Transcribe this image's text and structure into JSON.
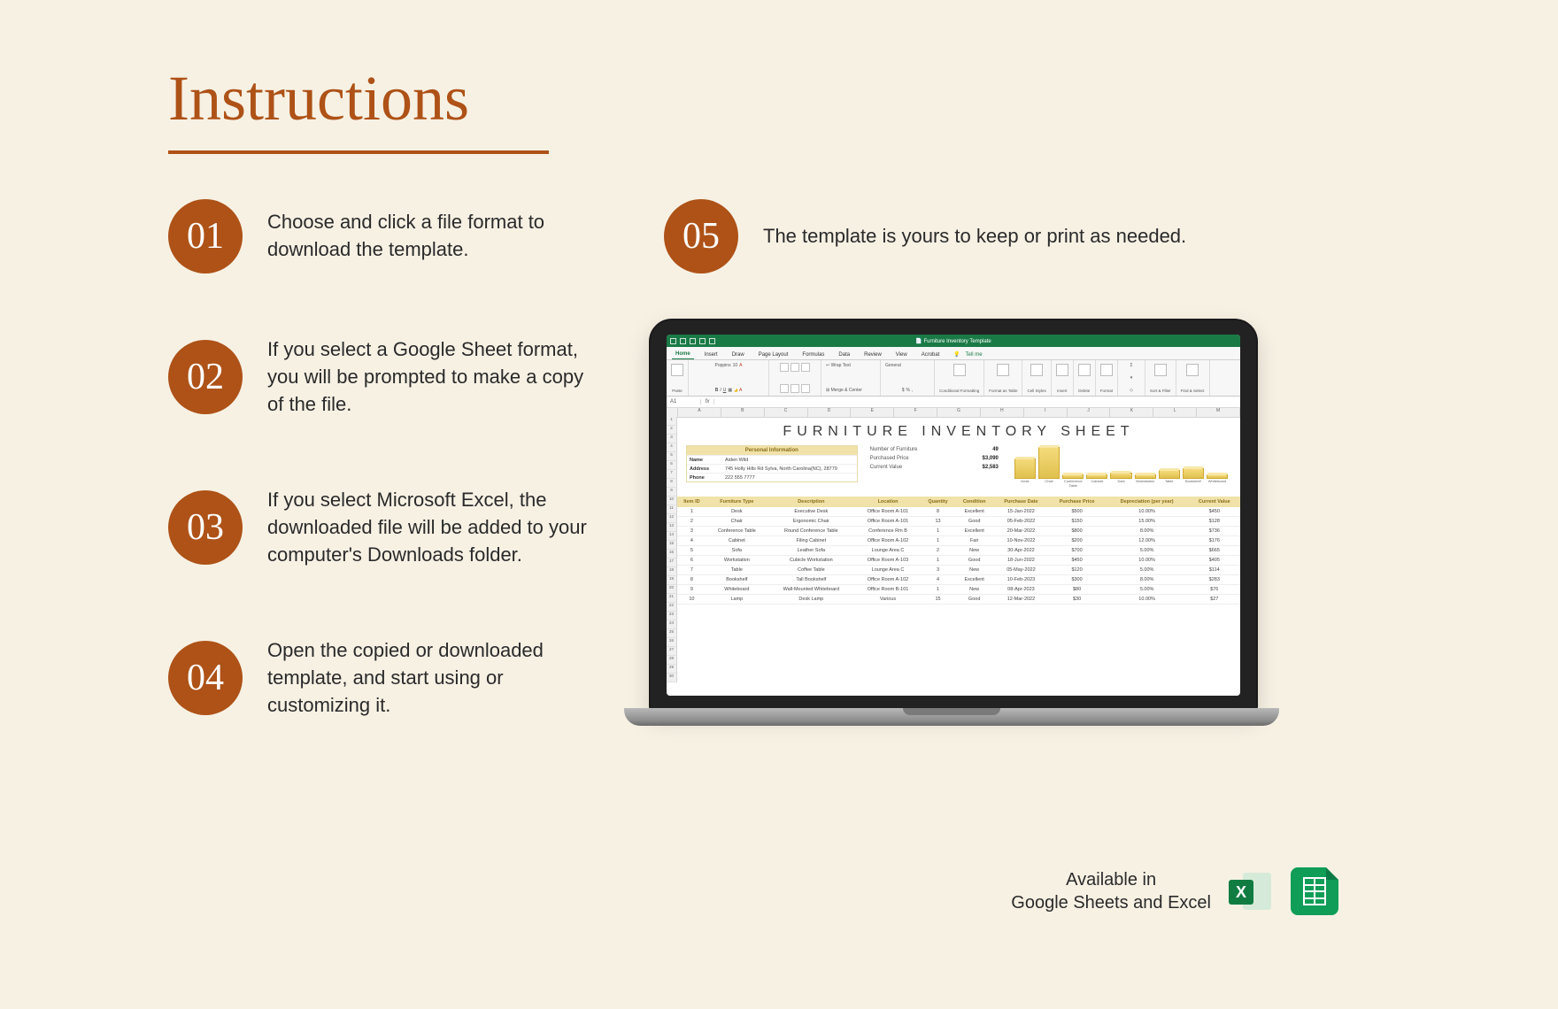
{
  "title": "Instructions",
  "steps": [
    {
      "num": "01",
      "text": "Choose and click a file format to download the template."
    },
    {
      "num": "02",
      "text": "If you select a Google Sheet format, you will be prompted to make a copy of the file."
    },
    {
      "num": "03",
      "text": "If you select Microsoft Excel, the downloaded file will be added to your computer's Downloads folder."
    },
    {
      "num": "04",
      "text": "Open the copied or downloaded template, and start using or customizing it."
    },
    {
      "num": "05",
      "text": "The template is yours to keep or print as needed."
    }
  ],
  "availability": {
    "line1": "Available in",
    "line2": "Google Sheets and Excel"
  },
  "excel": {
    "titlebar": {
      "filename": "Furniture Inventory Template"
    },
    "tabs": [
      "Home",
      "Insert",
      "Draw",
      "Page Layout",
      "Formulas",
      "Data",
      "Review",
      "View",
      "Acrobat"
    ],
    "tellme": "Tell me",
    "ribbon": {
      "paste": "Paste",
      "font_name": "Poppins",
      "font_size": "10",
      "wrap": "Wrap Text",
      "merge": "Merge & Center",
      "number_fmt": "General",
      "conditional": "Conditional Formatting",
      "format_table": "Format as Table",
      "cell_styles": "Cell Styles",
      "insert": "Insert",
      "delete": "Delete",
      "format": "Format",
      "sort": "Sort & Filter",
      "find": "Find & Select"
    },
    "formulabar": {
      "cell": "A1",
      "fx": "fx"
    },
    "sheet_title": "FURNITURE INVENTORY SHEET",
    "personal": {
      "header": "Personal Information",
      "name_k": "Name",
      "name_v": "Aiden Wild",
      "addr_k": "Address",
      "addr_v": "745 Holly Hills Rd Sylva, North Carolina(NC), 28779",
      "phone_k": "Phone",
      "phone_v": "222 555 7777"
    },
    "summary": {
      "count_k": "Number of Furniture",
      "count_v": "49",
      "price_k": "Purchased Price",
      "price_v": "$3,090",
      "value_k": "Current Value",
      "value_v": "$2,583"
    },
    "chart": {
      "labels": [
        "Desk",
        "Chair",
        "Conference Table",
        "Cabinet",
        "Sofa",
        "Workstation",
        "Table",
        "Bookshelf",
        "Whiteboard"
      ]
    },
    "columns": [
      "Item ID",
      "Furniture Type",
      "Description",
      "Location",
      "Quantity",
      "Condition",
      "Purchase Date",
      "Purchase Price",
      "Depreciation (per year)",
      "Current Value"
    ],
    "rows": [
      {
        "id": "1",
        "type": "Desk",
        "desc": "Executive Desk",
        "loc": "Office Room A-101",
        "qty": "8",
        "cond": "Excellent",
        "cond_class": "excellent",
        "date": "15-Jan-2022",
        "price": "$500",
        "dep": "10.00%",
        "val": "$450"
      },
      {
        "id": "2",
        "type": "Chair",
        "desc": "Ergonomic Chair",
        "loc": "Office Room A-101",
        "qty": "13",
        "cond": "Good",
        "cond_class": "good",
        "date": "05-Feb-2022",
        "price": "$150",
        "dep": "15.00%",
        "val": "$128"
      },
      {
        "id": "3",
        "type": "Conference Table",
        "desc": "Round Conference Table",
        "loc": "Conference Rm B",
        "qty": "1",
        "cond": "Excellent",
        "cond_class": "excellent",
        "date": "20-Mar-2022",
        "price": "$800",
        "dep": "8.00%",
        "val": "$736"
      },
      {
        "id": "4",
        "type": "Cabinet",
        "desc": "Filing Cabinet",
        "loc": "Office Room A-102",
        "qty": "1",
        "cond": "Fair",
        "cond_class": "fair",
        "date": "10-Nov-2022",
        "price": "$200",
        "dep": "12.00%",
        "val": "$176"
      },
      {
        "id": "5",
        "type": "Sofa",
        "desc": "Leather Sofa",
        "loc": "Lounge Area C",
        "qty": "2",
        "cond": "New",
        "cond_class": "new",
        "date": "30-Apr-2022",
        "price": "$700",
        "dep": "5.00%",
        "val": "$665"
      },
      {
        "id": "6",
        "type": "Workstation",
        "desc": "Cubicle Workstation",
        "loc": "Office Room A-103",
        "qty": "1",
        "cond": "Good",
        "cond_class": "good",
        "date": "18-Jun-2022",
        "price": "$450",
        "dep": "10.00%",
        "val": "$405"
      },
      {
        "id": "7",
        "type": "Table",
        "desc": "Coffee Table",
        "loc": "Lounge Area C",
        "qty": "3",
        "cond": "New",
        "cond_class": "new",
        "date": "05-May-2022",
        "price": "$120",
        "dep": "5.00%",
        "val": "$114"
      },
      {
        "id": "8",
        "type": "Bookshelf",
        "desc": "Tall Bookshelf",
        "loc": "Office Room A-102",
        "qty": "4",
        "cond": "Excellent",
        "cond_class": "excellent",
        "date": "10-Feb-2023",
        "price": "$300",
        "dep": "8.00%",
        "val": "$283"
      },
      {
        "id": "9",
        "type": "Whiteboard",
        "desc": "Wall-Mounted Whiteboard",
        "loc": "Office Room B-101",
        "qty": "1",
        "cond": "New",
        "cond_class": "new",
        "date": "08-Apr-2023",
        "price": "$80",
        "dep": "5.00%",
        "val": "$76"
      },
      {
        "id": "10",
        "type": "Lamp",
        "desc": "Desk Lamp",
        "loc": "Various",
        "qty": "15",
        "cond": "Good",
        "cond_class": "good",
        "date": "12-Mar-2022",
        "price": "$30",
        "dep": "10.00%",
        "val": "$27"
      }
    ]
  },
  "chart_data": {
    "type": "bar",
    "categories": [
      "Desk",
      "Chair",
      "Conference Table",
      "Cabinet",
      "Sofa",
      "Workstation",
      "Table",
      "Bookshelf",
      "Whiteboard"
    ],
    "values": [
      8,
      13,
      1,
      1,
      2,
      1,
      3,
      4,
      1
    ],
    "title": "",
    "xlabel": "",
    "ylabel": "",
    "ylim": [
      0,
      15
    ]
  }
}
